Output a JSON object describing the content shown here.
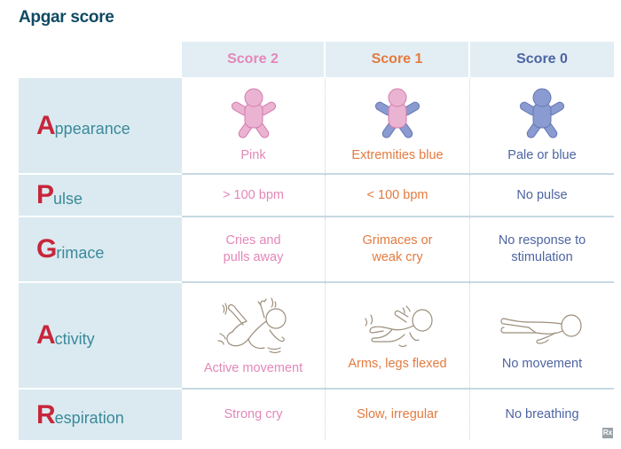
{
  "title": "Apgar score",
  "headers": [
    "Score 2",
    "Score 1",
    "Score 0"
  ],
  "colors": {
    "score2": "#e387b9",
    "score1": "#e37a3f",
    "score0": "#4d64a3",
    "criterion_initial": "#c7263b",
    "criterion_rest": "#3a8a99",
    "title": "#0f4a63",
    "header_bg": "#e2eef4",
    "label_bg": "#dbeaf1"
  },
  "rows": [
    {
      "initial": "A",
      "rest": "ppearance",
      "cells": [
        {
          "text": "Pink",
          "icon": "pink-baby-icon"
        },
        {
          "text": "Extremities blue",
          "icon": "blue-extremities-baby-icon"
        },
        {
          "text": "Pale or blue",
          "icon": "blue-baby-icon"
        }
      ]
    },
    {
      "initial": "P",
      "rest": "ulse",
      "cells": [
        {
          "text": "> 100 bpm"
        },
        {
          "text": "< 100 bpm"
        },
        {
          "text": "No pulse"
        }
      ]
    },
    {
      "initial": "G",
      "rest": "rimace",
      "cells": [
        {
          "line1": "Cries and",
          "line2": "pulls away"
        },
        {
          "line1": "Grimaces or",
          "line2": "weak cry"
        },
        {
          "line1": "No response to",
          "line2": "stimulation"
        }
      ]
    },
    {
      "initial": "A",
      "rest": "ctivity",
      "cells": [
        {
          "text": "Active movement",
          "icon": "active-infant-drawing-icon"
        },
        {
          "text": "Arms, legs flexed",
          "icon": "flexed-infant-drawing-icon"
        },
        {
          "text": "No movement",
          "icon": "limp-infant-drawing-icon"
        }
      ]
    },
    {
      "initial": "R",
      "rest": "espiration",
      "cells": [
        {
          "text": "Strong cry"
        },
        {
          "text": "Slow, irregular"
        },
        {
          "text": "No breathing"
        }
      ]
    }
  ],
  "watermark": "Rx"
}
